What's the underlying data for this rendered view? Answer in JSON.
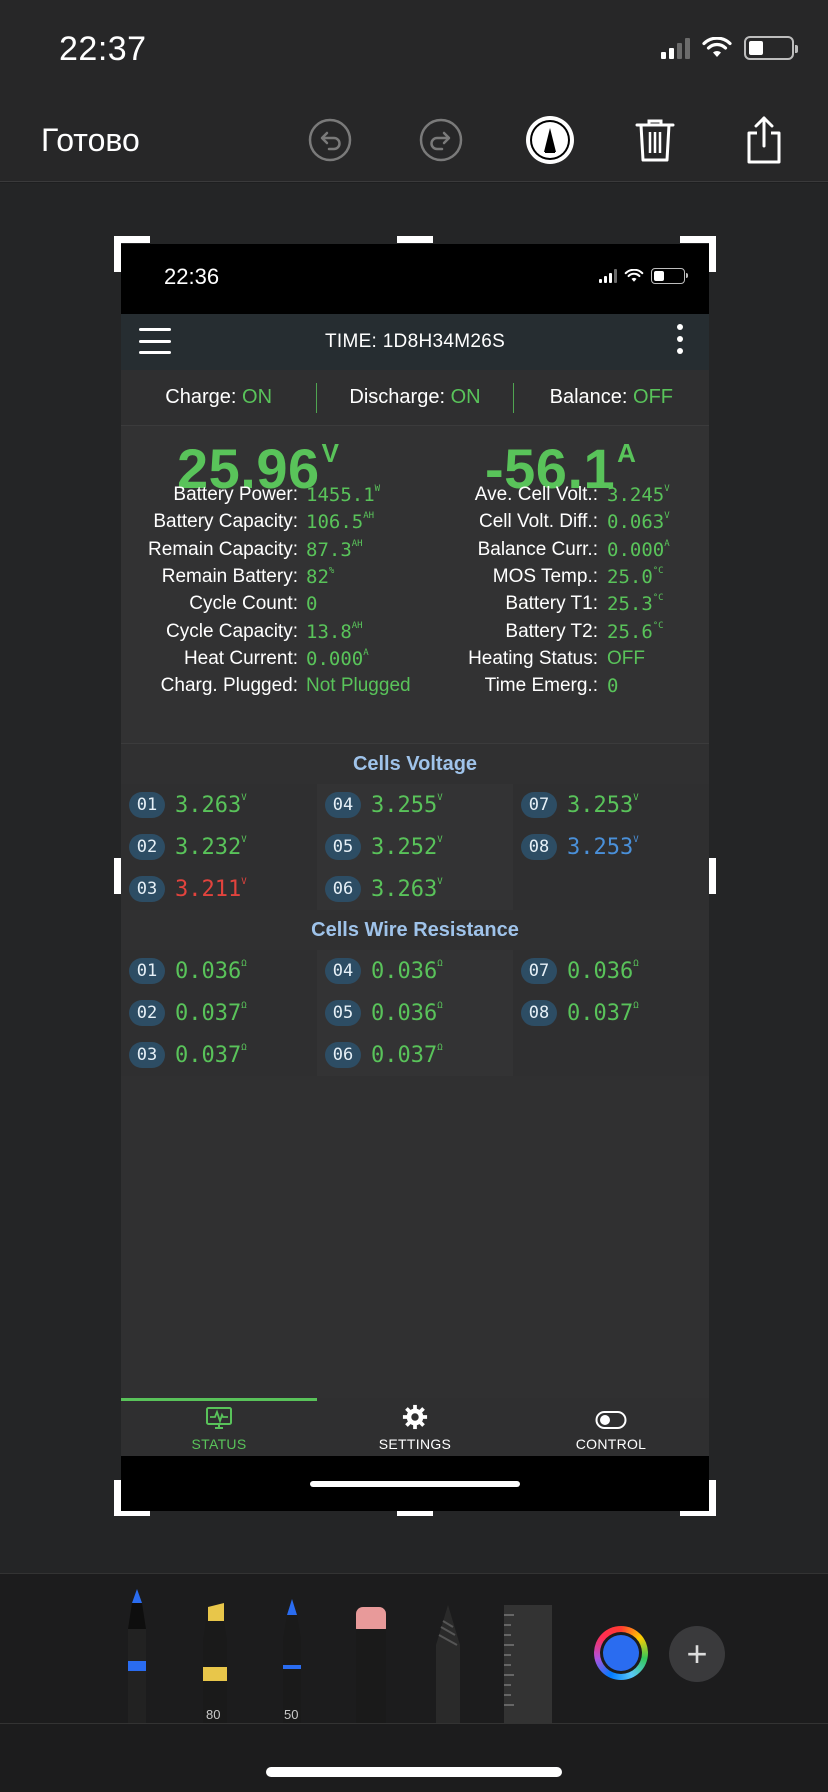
{
  "os_status": {
    "time": "22:37"
  },
  "editor_toolbar": {
    "done_label": "Готово"
  },
  "inner_status": {
    "time": "22:36"
  },
  "app_header": {
    "title": "TIME: 1D8H34M26S"
  },
  "status_row": {
    "charge_label": "Charge:",
    "charge_value": "ON",
    "discharge_label": "Discharge:",
    "discharge_value": "ON",
    "balance_label": "Balance:",
    "balance_value": "OFF"
  },
  "main_readout": {
    "voltage": "25.96",
    "voltage_unit": "V",
    "current": "-56.1",
    "current_unit": "A"
  },
  "left_metrics": [
    {
      "label": "Battery Power:",
      "value": "1455.1",
      "unit": "W"
    },
    {
      "label": "Battery Capacity:",
      "value": "106.5",
      "unit": "AH"
    },
    {
      "label": "Remain Capacity:",
      "value": "87.3",
      "unit": "AH"
    },
    {
      "label": "Remain Battery:",
      "value": "82",
      "unit": "%"
    },
    {
      "label": "Cycle Count:",
      "value": "0",
      "unit": ""
    },
    {
      "label": "Cycle Capacity:",
      "value": "13.8",
      "unit": "AH"
    },
    {
      "label": "Heat Current:",
      "value": "0.000",
      "unit": "A"
    },
    {
      "label": "Charg. Plugged:",
      "value": "Not Plugged",
      "unit": ""
    }
  ],
  "right_metrics": [
    {
      "label": "Ave. Cell Volt.:",
      "value": "3.245",
      "unit": "V"
    },
    {
      "label": "Cell Volt. Diff.:",
      "value": "0.063",
      "unit": "V"
    },
    {
      "label": "Balance Curr.:",
      "value": "0.000",
      "unit": "A"
    },
    {
      "label": "MOS Temp.:",
      "value": "25.0",
      "unit": "°C"
    },
    {
      "label": "Battery T1:",
      "value": "25.3",
      "unit": "°C"
    },
    {
      "label": "Battery T2:",
      "value": "25.6",
      "unit": "°C"
    },
    {
      "label": "Heating Status:",
      "value": "OFF",
      "unit": ""
    },
    {
      "label": "Time Emerg.:",
      "value": "0",
      "unit": ""
    }
  ],
  "cells_voltage": {
    "title": "Cells Voltage",
    "unit": "V",
    "cells": [
      {
        "id": "01",
        "value": "3.263",
        "state": "normal"
      },
      {
        "id": "02",
        "value": "3.232",
        "state": "normal"
      },
      {
        "id": "03",
        "value": "3.211",
        "state": "min"
      },
      {
        "id": "04",
        "value": "3.255",
        "state": "normal"
      },
      {
        "id": "05",
        "value": "3.252",
        "state": "normal"
      },
      {
        "id": "06",
        "value": "3.263",
        "state": "normal"
      },
      {
        "id": "07",
        "value": "3.253",
        "state": "normal"
      },
      {
        "id": "08",
        "value": "3.253",
        "state": "max"
      }
    ]
  },
  "cells_resistance": {
    "title": "Cells Wire Resistance",
    "unit": "Ω",
    "cells": [
      {
        "id": "01",
        "value": "0.036"
      },
      {
        "id": "02",
        "value": "0.037"
      },
      {
        "id": "03",
        "value": "0.037"
      },
      {
        "id": "04",
        "value": "0.036"
      },
      {
        "id": "05",
        "value": "0.036"
      },
      {
        "id": "06",
        "value": "0.037"
      },
      {
        "id": "07",
        "value": "0.036"
      },
      {
        "id": "08",
        "value": "0.037"
      }
    ]
  },
  "tabs": [
    {
      "label": "STATUS",
      "icon": "monitor-pulse-icon",
      "active": true
    },
    {
      "label": "SETTINGS",
      "icon": "gear-icon",
      "active": false
    },
    {
      "label": "CONTROL",
      "icon": "toggle-icon",
      "active": false
    }
  ],
  "palette": {
    "marker_size": "80",
    "pencil_size": "50",
    "selected_color": "#2a6cf0"
  },
  "colors": {
    "accent_green": "#59c35a",
    "min_red": "#e2433d",
    "max_blue": "#4a90d9",
    "section_title": "#9fc3ea"
  }
}
